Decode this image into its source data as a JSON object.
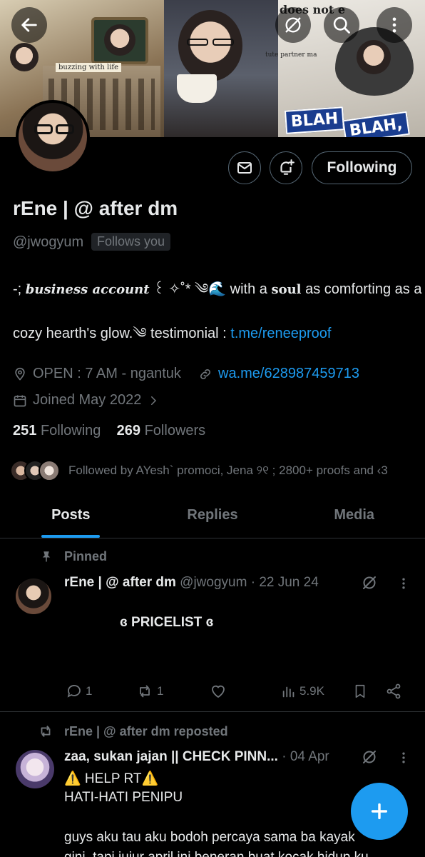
{
  "profile": {
    "display_name": "rEne | @ after dm",
    "handle": "@jwogyum",
    "follows_you": "Follows you",
    "follow_button": "Following",
    "bio": {
      "line1_prefix": "-; ",
      "line1_italic": "business account",
      "line1_deco": " ꒰ ✧˚* ༄🌊",
      "line1_text": " with a ",
      "line1_bold": "soul",
      "line1_rest": " as comforting as a",
      "line2_text": "cozy hearth's glow.༄ testimonial : ",
      "line2_link": "t.me/reneeproof"
    },
    "location": "OPEN : 7 AM - ngantuk",
    "website": "wa.me/628987459713",
    "joined": "Joined May 2022",
    "following_count": "251",
    "following_label": "Following",
    "followers_count": "269",
    "followers_label": "Followers",
    "followed_by": "Followed by AYesh` promoci, Jena ୨୧ ; 2800+ proofs and ‹3"
  },
  "banner": {
    "tv_caption": "buzzing with life",
    "blah1": "BLAH",
    "blah2": "BLAH,",
    "note1": "does not e",
    "note2": "tute partner ma"
  },
  "tabs": [
    {
      "label": "Posts"
    },
    {
      "label": "Replies"
    },
    {
      "label": "Media"
    }
  ],
  "pinned_post": {
    "pinned_label": "Pinned",
    "author": "rEne | @ after dm",
    "handle": "@jwogyum",
    "date": "· 22 Jun 24",
    "text": "ɞ PRICELIST ɞ",
    "replies": "1",
    "reposts": "1",
    "views": "5.9K"
  },
  "repost": {
    "reposted_label": "rEne | @ after dm reposted",
    "author": "zaa, sukan jajan || CHECK PINN...",
    "date": "· 04 Apr",
    "line1": "⚠️ HELP RT⚠️",
    "line2": "HATI-HATI PENIPU",
    "line3": "guys aku tau aku bodoh percaya sama ba kayak",
    "line4": "gini, tapi jujur april ini beneran buat kocak hidup ku"
  },
  "colors": {
    "accent": "#1d9bf0",
    "muted": "#71767b",
    "background": "#000000",
    "border": "#2f3336"
  },
  "icons": [
    "back-arrow-icon",
    "grok-icon",
    "search-icon",
    "more-vertical-icon",
    "mail-icon",
    "bell-plus-icon",
    "location-icon",
    "link-icon",
    "calendar-icon",
    "chevron-right-icon",
    "pin-icon",
    "reply-icon",
    "repost-icon",
    "like-icon",
    "views-icon",
    "bookmark-icon",
    "share-icon",
    "plus-icon"
  ]
}
